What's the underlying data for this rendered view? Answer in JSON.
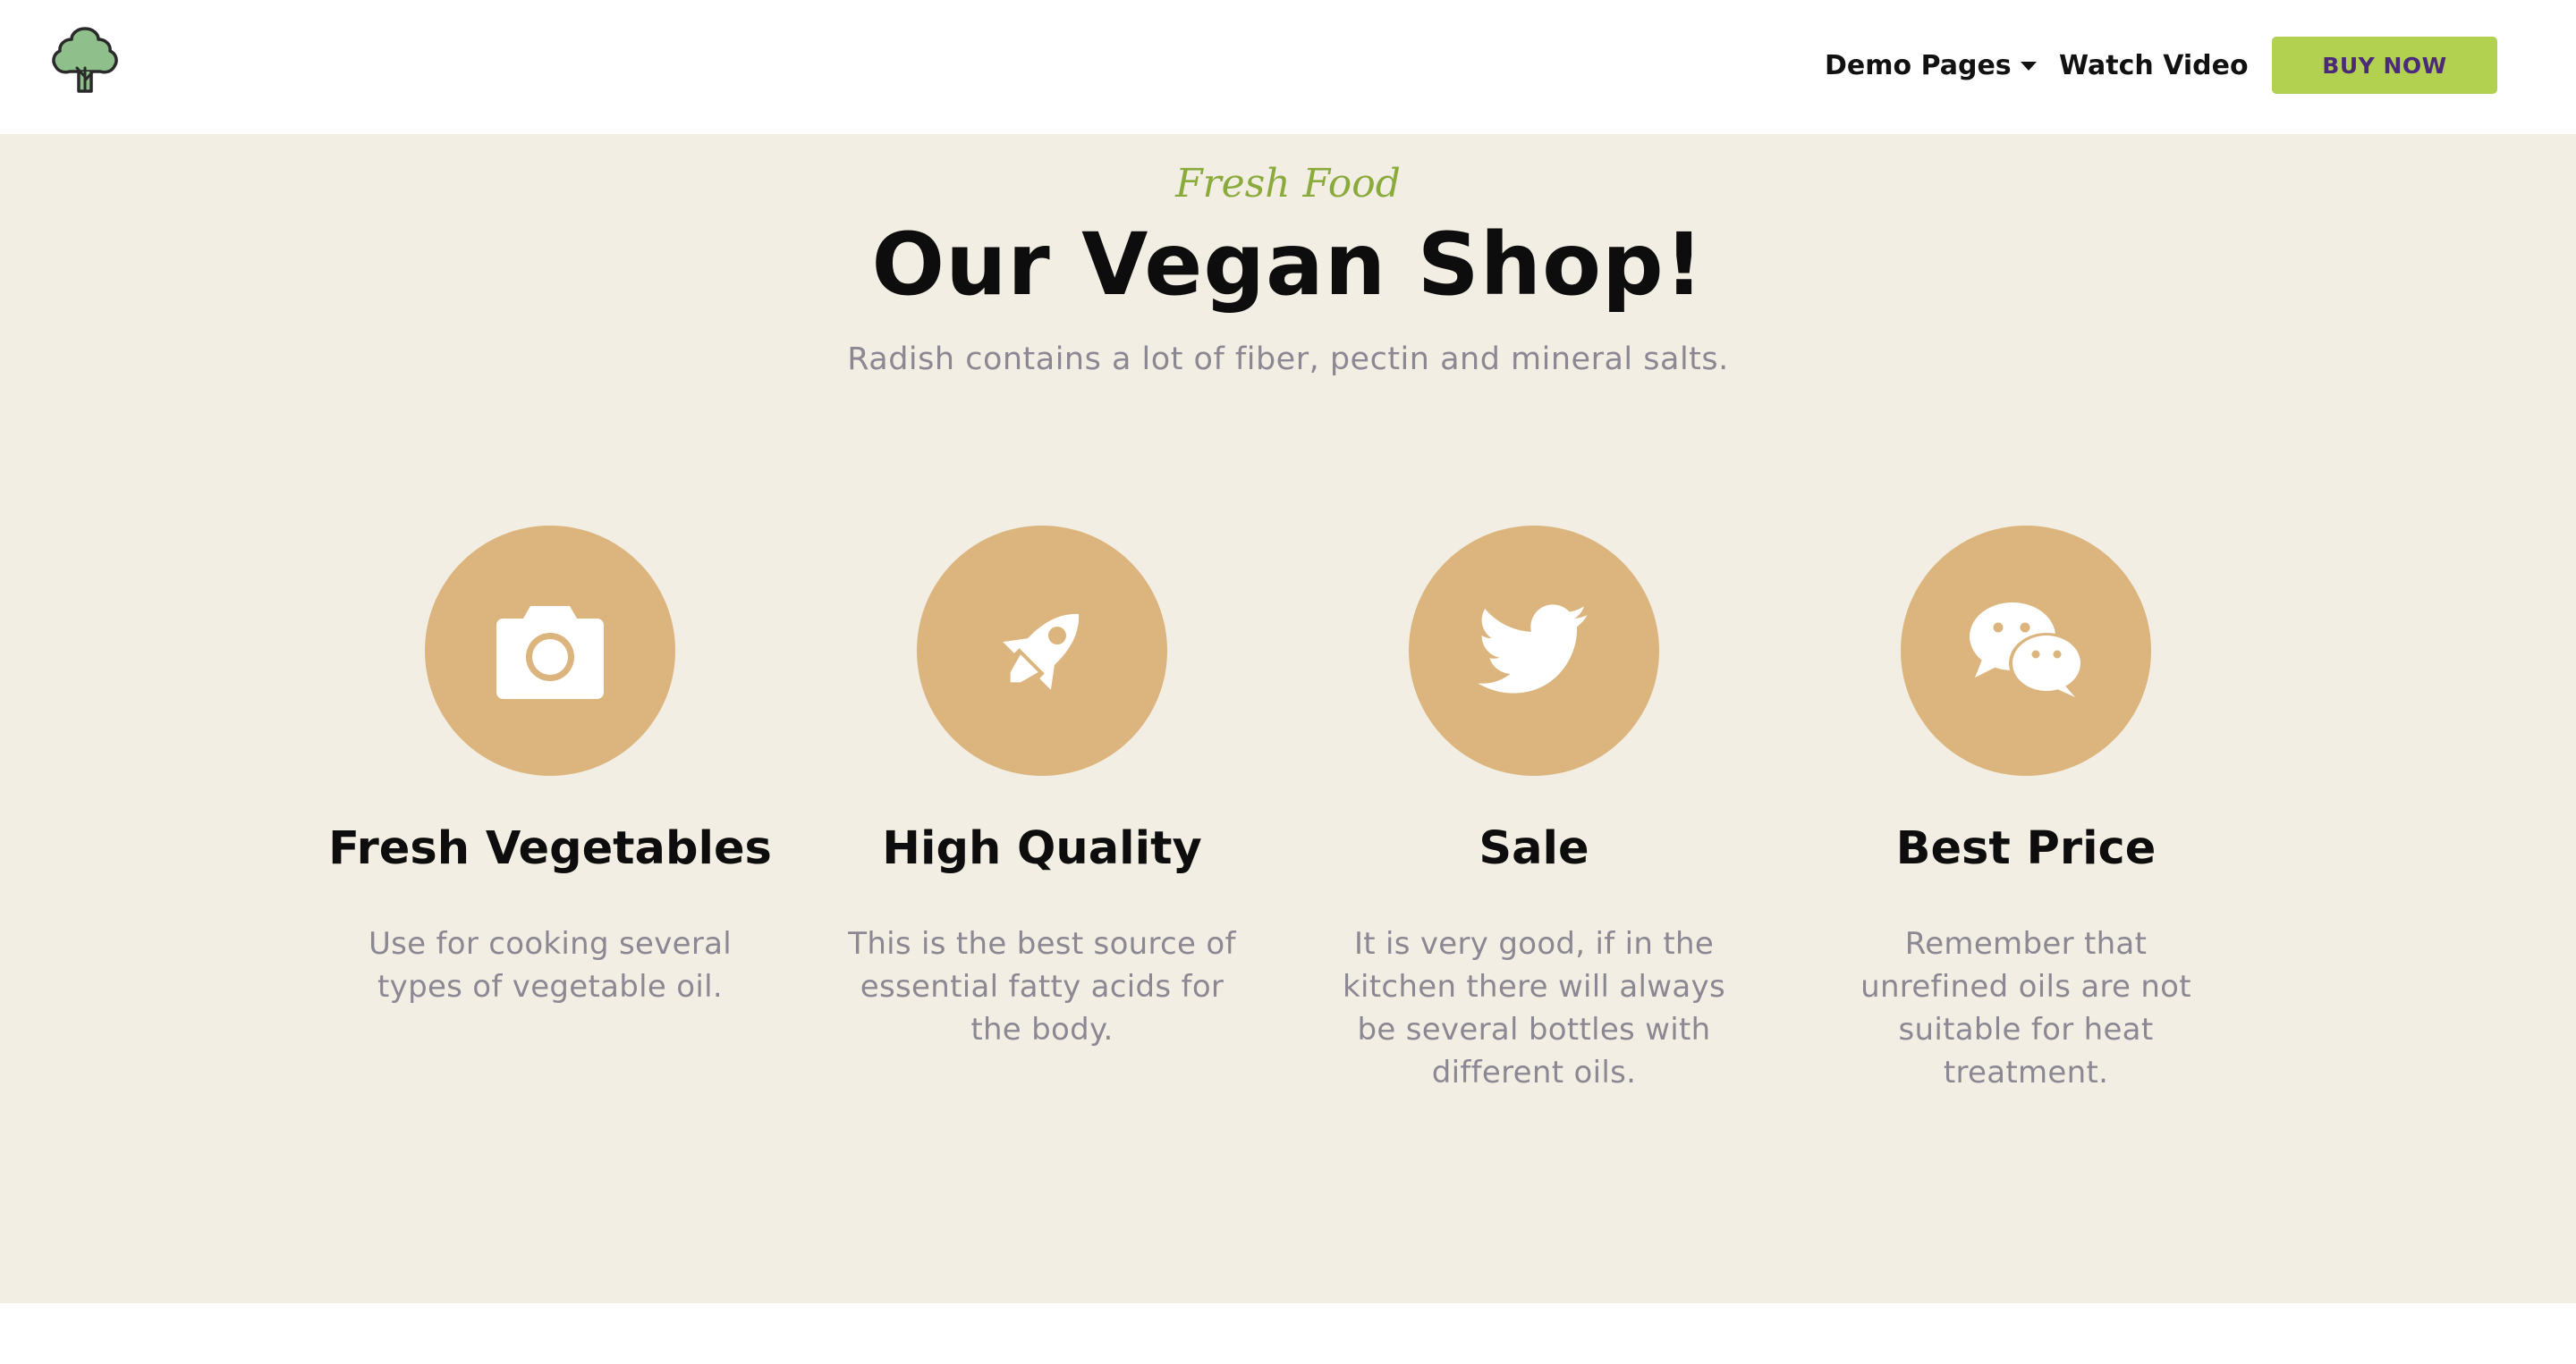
{
  "header": {
    "logo_icon": "broccoli-tree-icon",
    "nav": {
      "demo_pages": "Demo Pages",
      "watch_video": "Watch Video"
    },
    "buy_button": "BUY NOW"
  },
  "hero": {
    "eyebrow": "Fresh Food",
    "title": "Our Vegan Shop!",
    "subtitle": "Radish contains a lot of fiber, pectin and mineral salts."
  },
  "features": [
    {
      "icon": "camera-icon",
      "title": "Fresh Vegetables",
      "description": "Use for cooking several types of vegetable oil."
    },
    {
      "icon": "rocket-icon",
      "title": "High Quality",
      "description": "This is the best source of essential fatty acids for the body."
    },
    {
      "icon": "twitter-icon",
      "title": "Sale",
      "description": "It is very good, if in the kitchen there will always be several bottles with different oils."
    },
    {
      "icon": "wechat-icon",
      "title": "Best Price",
      "description": "Remember that unrefined oils are not suitable for heat treatment."
    }
  ],
  "colors": {
    "accent_green": "#b2d151",
    "eyebrow_green": "#8aab3c",
    "icon_circle": "#dbb57d",
    "section_bg": "#f3eee3",
    "muted_text": "#8b8893"
  }
}
